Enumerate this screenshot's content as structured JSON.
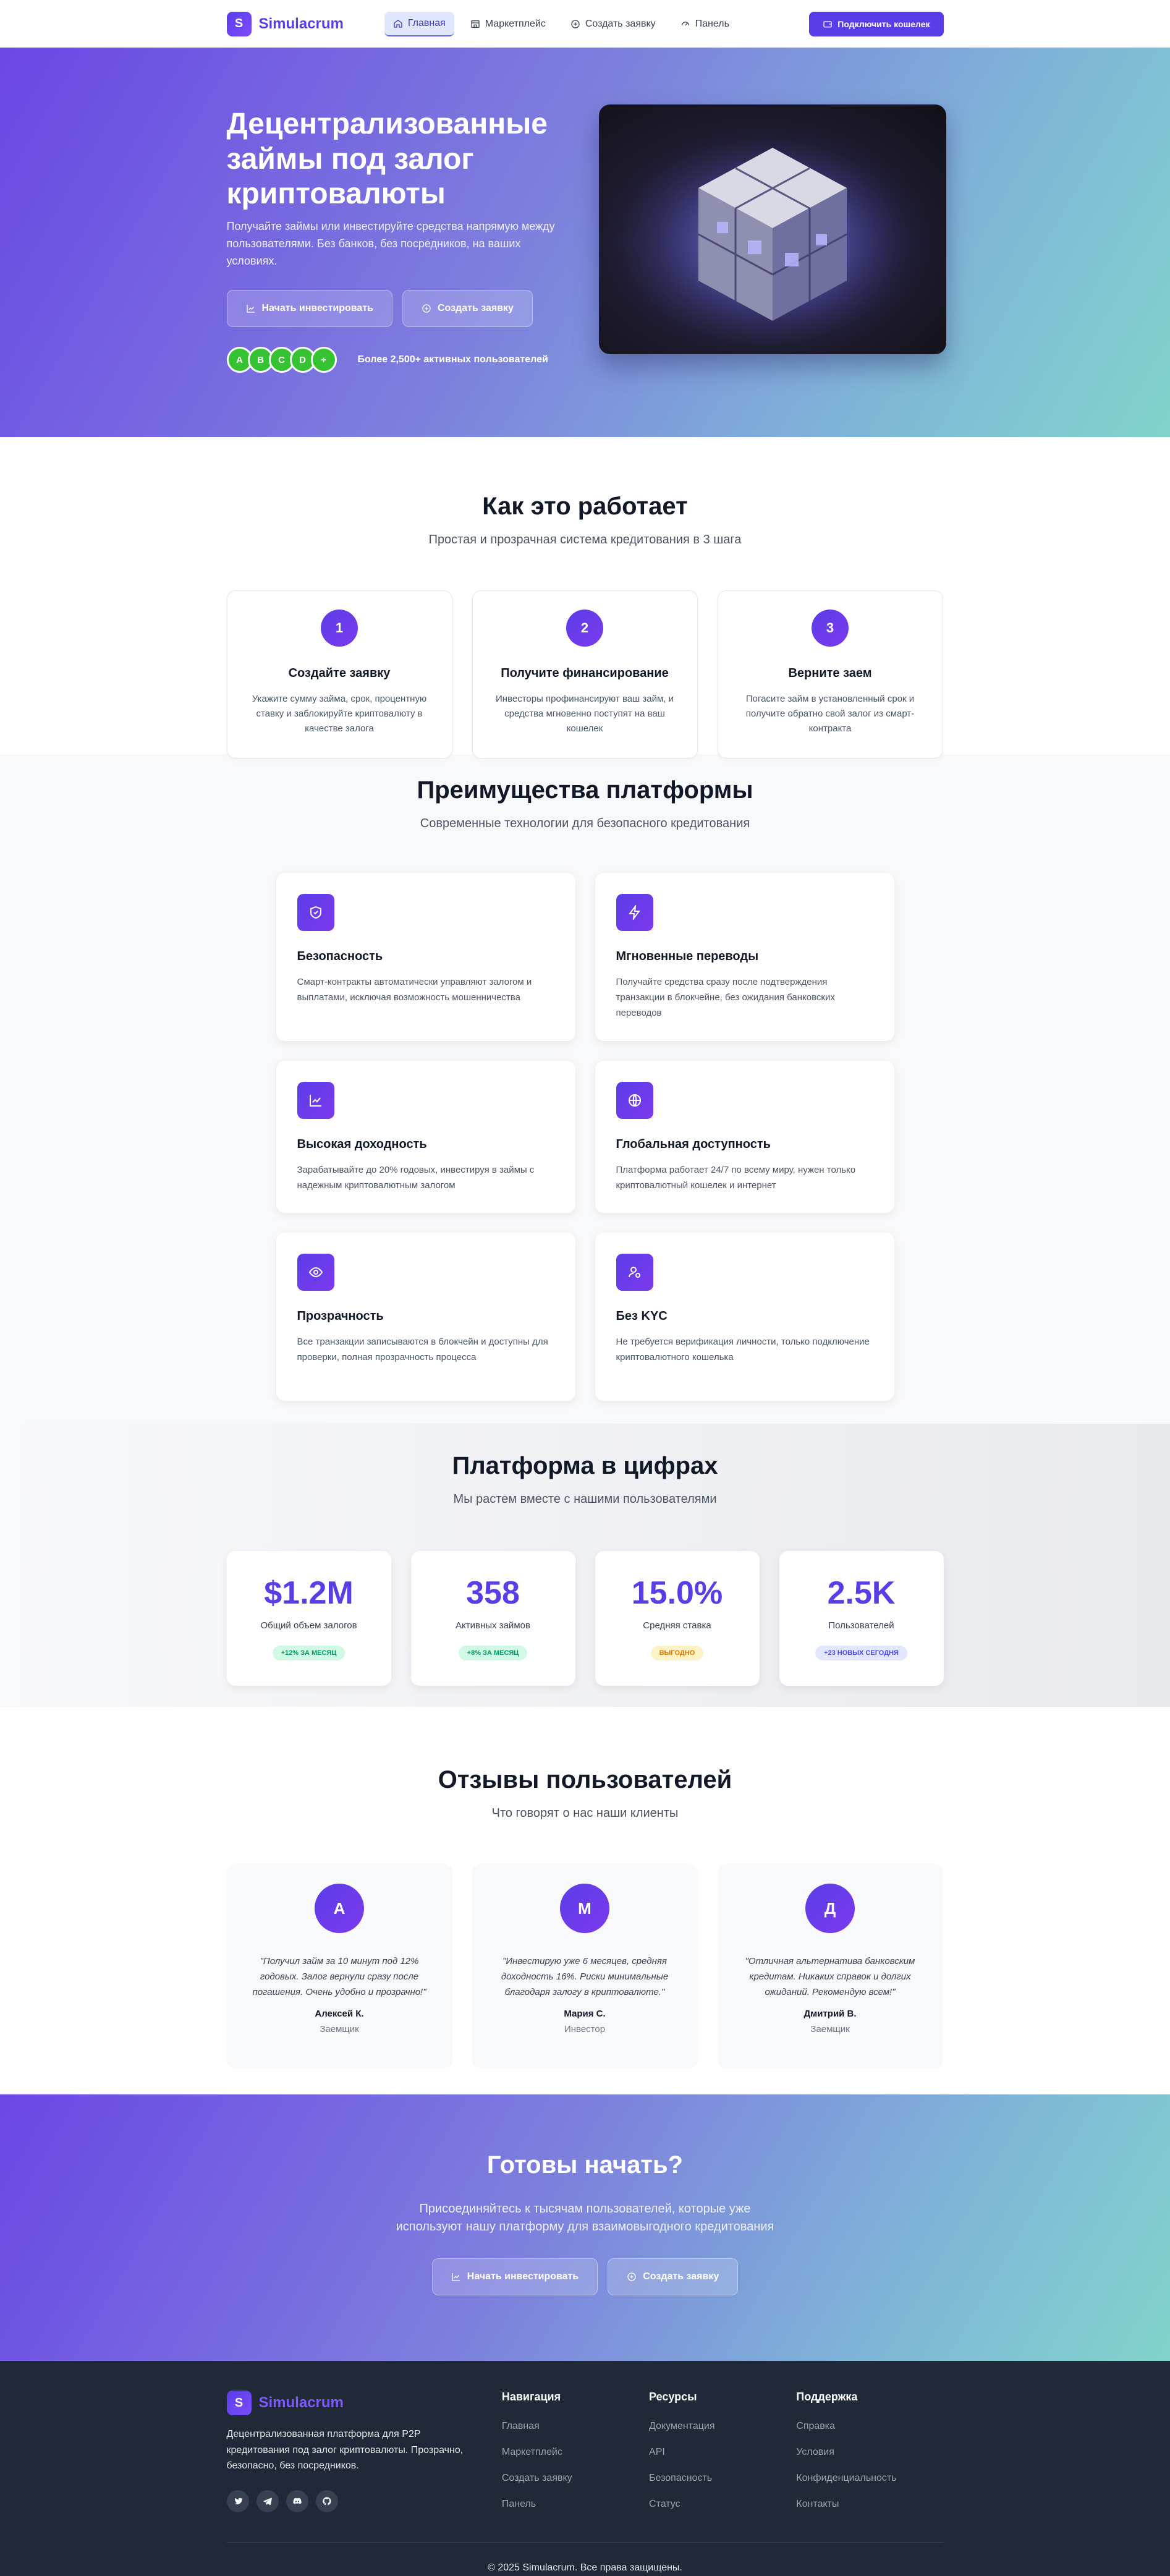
{
  "brand": {
    "logo_letter": "S",
    "name": "Simulacrum"
  },
  "nav": {
    "items": [
      {
        "label": "Главная",
        "icon": "home-icon"
      },
      {
        "label": "Маркетплейс",
        "icon": "store-icon"
      },
      {
        "label": "Создать заявку",
        "icon": "plus-circle-icon"
      },
      {
        "label": "Панель",
        "icon": "dashboard-icon"
      }
    ],
    "connect_label": "Подключить кошелек"
  },
  "hero": {
    "title": "Децентрализованные займы под залог криптовалюты",
    "subtitle": "Получайте займы или инвестируйте средства напрямую между пользователями. Без банков, без посредников, на ваших условиях.",
    "btn_invest": "Начать инвестировать",
    "btn_create": "Создать заявку",
    "avatars": [
      "A",
      "B",
      "C",
      "D",
      "+"
    ],
    "users_text": "Более 2,500+ активных пользователей"
  },
  "how": {
    "title": "Как это работает",
    "subtitle": "Простая и прозрачная система кредитования в 3 шага",
    "steps": [
      {
        "num": "1",
        "title": "Создайте заявку",
        "text": "Укажите сумму займа, срок, процентную ставку и заблокируйте криптовалюту в качестве залога"
      },
      {
        "num": "2",
        "title": "Получите финансирование",
        "text": "Инвесторы профинансируют ваш займ, и средства мгновенно поступят на ваш кошелек"
      },
      {
        "num": "3",
        "title": "Верните заем",
        "text": "Погасите займ в установленный срок и получите обратно свой залог из смарт-контракта"
      }
    ]
  },
  "advantages": {
    "title": "Преимущества платформы",
    "subtitle": "Современные технологии для безопасного кредитования",
    "items": [
      {
        "icon": "shield-icon",
        "title": "Безопасность",
        "text": "Смарт-контракты автоматически управляют залогом и выплатами, исключая возможность мошенничества"
      },
      {
        "icon": "lightning-icon",
        "title": "Мгновенные переводы",
        "text": "Получайте средства сразу после подтверждения транзакции в блокчейне, без ожидания банковских переводов"
      },
      {
        "icon": "chart-up-icon",
        "title": "Высокая доходность",
        "text": "Зарабатывайте до 20% годовых, инвестируя в займы с надежным криптовалютным залогом"
      },
      {
        "icon": "globe-icon",
        "title": "Глобальная доступность",
        "text": "Платформа работает 24/7 по всему миру, нужен только криптовалютный кошелек и интернет"
      },
      {
        "icon": "eye-icon",
        "title": "Прозрачность",
        "text": "Все транзакции записываются в блокчейн и доступны для проверки, полная прозрачность процесса"
      },
      {
        "icon": "user-check-icon",
        "title": "Без KYC",
        "text": "Не требуется верификация личности, только подключение криптовалютного кошелька"
      }
    ]
  },
  "stats": {
    "title": "Платформа в цифрах",
    "subtitle": "Мы растем вместе с нашими пользователями",
    "items": [
      {
        "value": "$1.2M",
        "label": "Общий объем залогов",
        "badge": "+12% за месяц",
        "badge_color": "#059669",
        "badge_bg": "#d1fae5"
      },
      {
        "value": "358",
        "label": "Активных займов",
        "badge": "+8% за месяц",
        "badge_color": "#059669",
        "badge_bg": "#d1fae5"
      },
      {
        "value": "15.0%",
        "label": "Средняя ставка",
        "badge": "Выгодно",
        "badge_color": "#d97706",
        "badge_bg": "#fef3c7"
      },
      {
        "value": "2.5K",
        "label": "Пользователей",
        "badge": "+23 новых сегодня",
        "badge_color": "#4f46e5",
        "badge_bg": "#e0e7ff"
      }
    ]
  },
  "reviews": {
    "title": "Отзывы пользователей",
    "subtitle": "Что говорят о нас наши клиенты",
    "items": [
      {
        "initial": "А",
        "text": "\"Получил займ за 10 минут под 12% годовых. Залог вернули сразу после погашения. Очень удобно и прозрачно!\"",
        "name": "Алексей К.",
        "role": "Заемщик"
      },
      {
        "initial": "М",
        "text": "\"Инвестирую уже 6 месяцев, средняя доходность 16%. Риски минимальные благодаря залогу в криптовалюте.\"",
        "name": "Мария С.",
        "role": "Инвестор"
      },
      {
        "initial": "Д",
        "text": "\"Отличная альтернатива банковским кредитам. Никаких справок и долгих ожиданий. Рекомендую всем!\"",
        "name": "Дмитрий В.",
        "role": "Заемщик"
      }
    ]
  },
  "cta": {
    "title": "Готовы начать?",
    "subtitle": "Присоединяйтесь к тысячам пользователей, которые уже используют нашу платформу для взаимовыгодного кредитования",
    "btn_invest": "Начать инвестировать",
    "btn_create": "Создать заявку"
  },
  "footer": {
    "description": "Децентрализованная платформа для P2P кредитования под залог криптовалюты. Прозрачно, безопасно, без посредников.",
    "socials": [
      "twitter-icon",
      "telegram-icon",
      "discord-icon",
      "github-icon"
    ],
    "columns": [
      {
        "title": "Навигация",
        "links": [
          "Главная",
          "Маркетплейс",
          "Создать заявку",
          "Панель"
        ]
      },
      {
        "title": "Ресурсы",
        "links": [
          "Документация",
          "API",
          "Безопасность",
          "Статус"
        ]
      },
      {
        "title": "Поддержка",
        "links": [
          "Справка",
          "Условия",
          "Конфиденциальность",
          "Контакты"
        ]
      }
    ],
    "copyright": "© 2025 Simulacrum. Все права защищены."
  },
  "colors": {
    "accent": "#5b3de8",
    "footer_bg": "#1f2937",
    "avatar_green": "#35c233"
  }
}
